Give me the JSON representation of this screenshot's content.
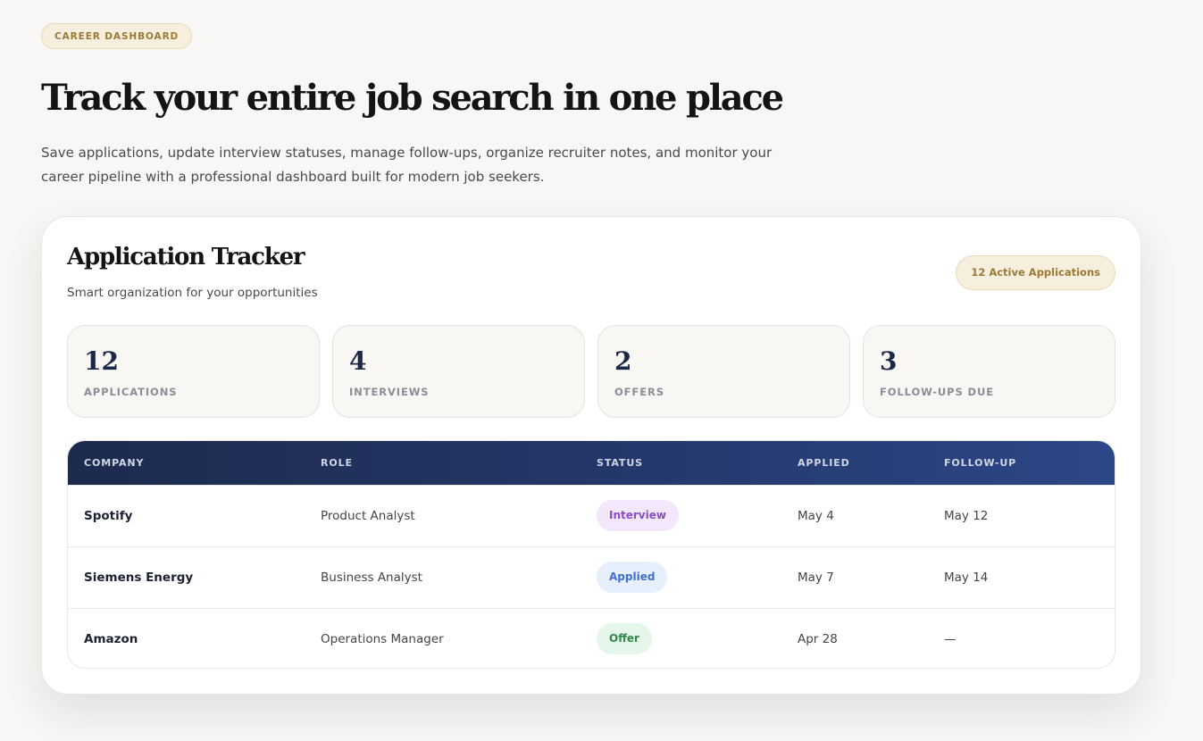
{
  "hero": {
    "eyebrow": "CAREER DASHBOARD",
    "title": "Track your entire job search in one place",
    "subtitle": "Save applications, update interview statuses, manage follow-ups, organize recruiter notes, and monitor your career pipeline with a professional dashboard built for modern job seekers."
  },
  "tracker": {
    "title": "Application Tracker",
    "subtitle": "Smart organization for your opportunities",
    "badge": "12 Active Applications",
    "stats": [
      {
        "value": "12",
        "label": "APPLICATIONS"
      },
      {
        "value": "4",
        "label": "INTERVIEWS"
      },
      {
        "value": "2",
        "label": "OFFERS"
      },
      {
        "value": "3",
        "label": "FOLLOW-UPS DUE"
      }
    ],
    "columns": [
      "COMPANY",
      "ROLE",
      "STATUS",
      "APPLIED",
      "FOLLOW-UP"
    ],
    "rows": [
      {
        "company": "Spotify",
        "role": "Product Analyst",
        "status": "Interview",
        "applied": "May 4",
        "follow_up": "May 12"
      },
      {
        "company": "Siemens Energy",
        "role": "Business Analyst",
        "status": "Applied",
        "applied": "May 7",
        "follow_up": "May 14"
      },
      {
        "company": "Amazon",
        "role": "Operations Manager",
        "status": "Offer",
        "applied": "Apr 28",
        "follow_up": "—"
      }
    ]
  },
  "colors": {
    "accent_gold": "#9c7a36",
    "navy": "#1b2846",
    "status_interview_bg": "#f3e8fb",
    "status_interview_fg": "#8a4cc9",
    "status_applied_bg": "#e6effc",
    "status_applied_fg": "#3f6fd1",
    "status_offer_bg": "#e5f6ea",
    "status_offer_fg": "#2f8a4b"
  }
}
